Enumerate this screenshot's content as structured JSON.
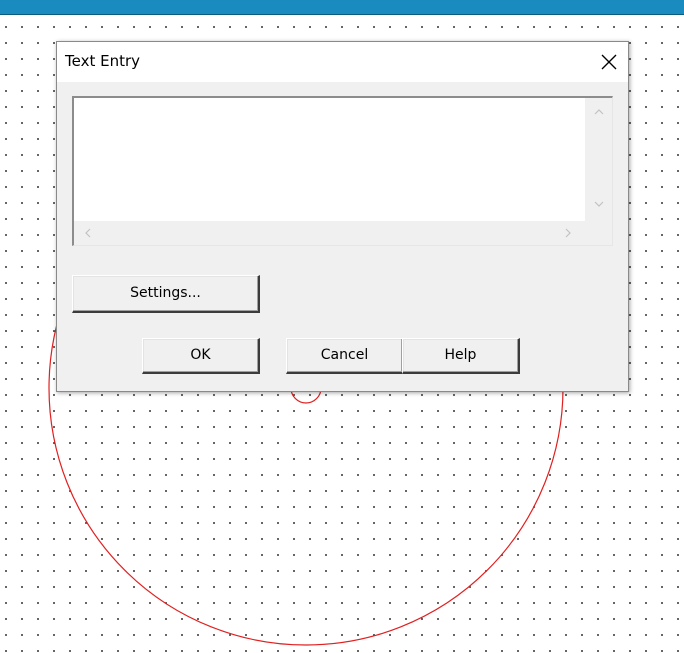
{
  "dialog": {
    "title": "Text Entry",
    "text_value": "",
    "buttons": {
      "settings": "Settings...",
      "ok": "OK",
      "cancel": "Cancel",
      "help": "Help"
    }
  },
  "icons": {
    "close": "close-icon",
    "scroll_up": "chevron-up-icon",
    "scroll_down": "chevron-down-icon",
    "scroll_left": "chevron-left-icon",
    "scroll_right": "chevron-right-icon"
  },
  "colors": {
    "top_bar": "#1a8bbf",
    "canvas_dots": "#3c3c3c",
    "circle_stroke": "#e02020",
    "dialog_bg": "#f0f0f0"
  }
}
